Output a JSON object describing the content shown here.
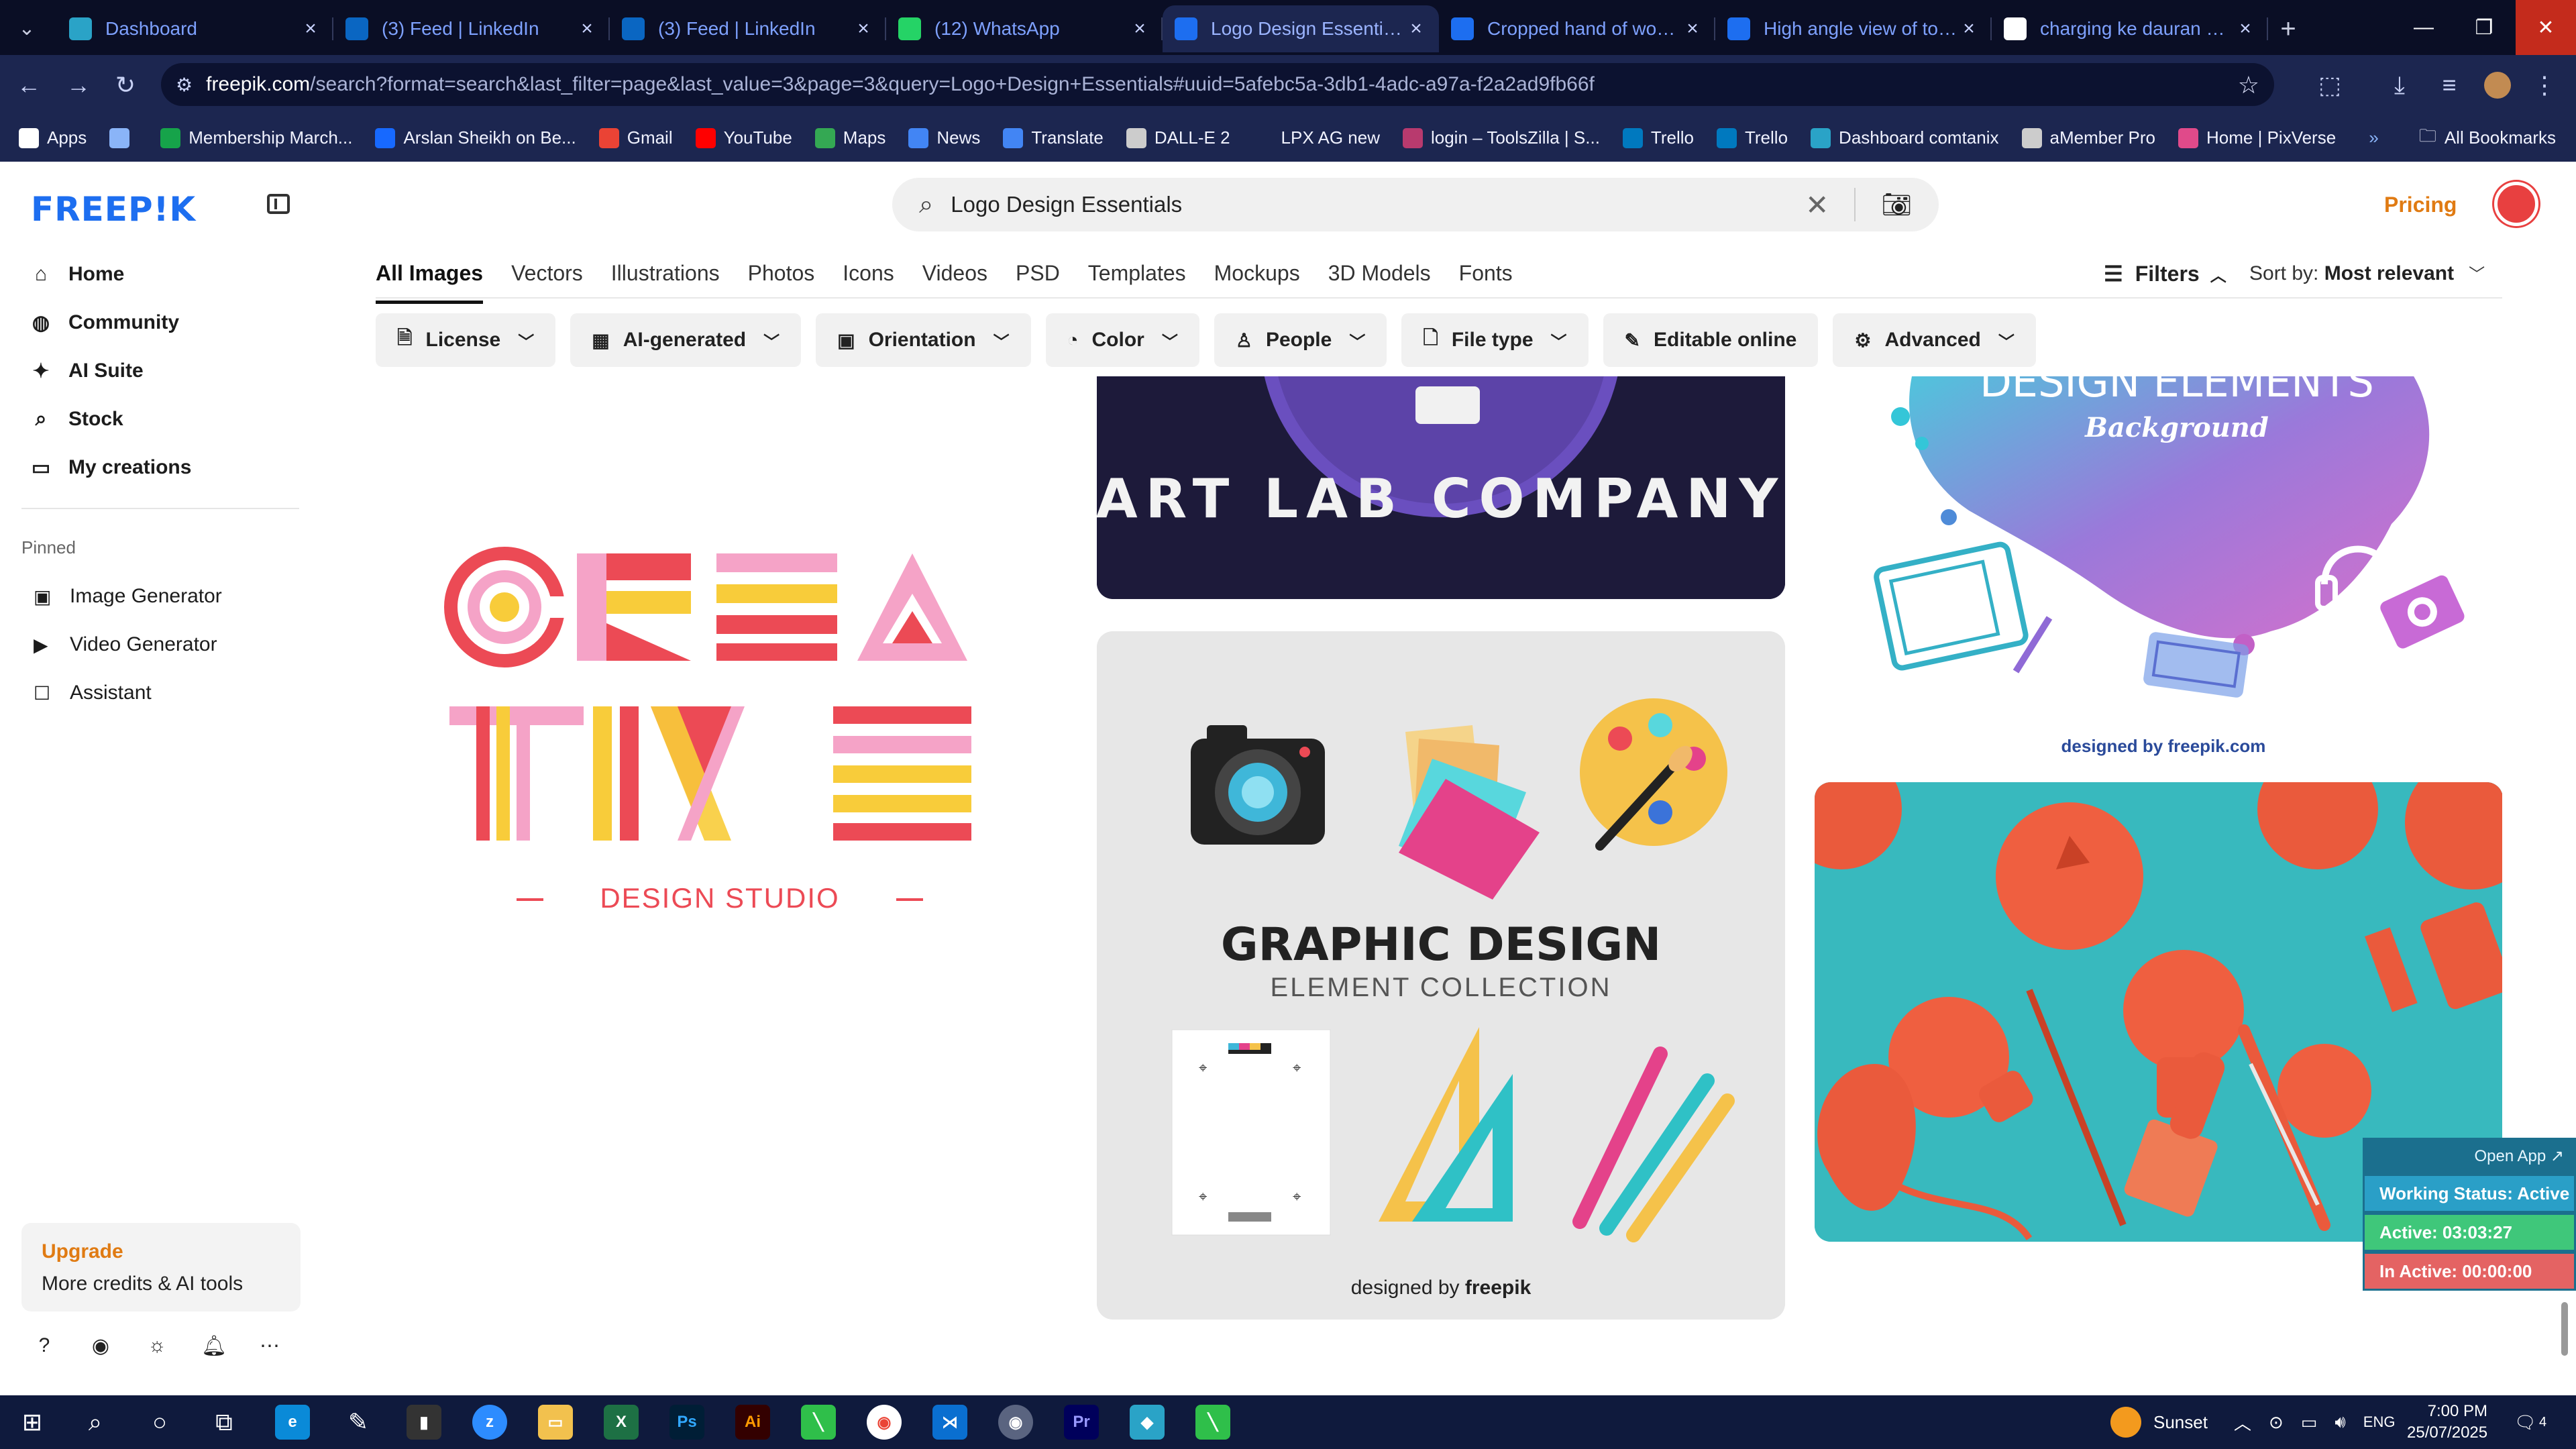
{
  "browser": {
    "tabs": [
      {
        "title": "Dashboard",
        "icon": "dashboard-tab-icon",
        "color": "#2aa3c7"
      },
      {
        "title": "(3) Feed | LinkedIn",
        "icon": "linkedin-icon",
        "color": "#0a66c2"
      },
      {
        "title": "(3) Feed | LinkedIn",
        "icon": "linkedin-icon",
        "color": "#0a66c2"
      },
      {
        "title": "(12) WhatsApp",
        "icon": "whatsapp-icon",
        "color": "#25d366"
      },
      {
        "title": "Logo Design Essentials ve",
        "icon": "freepik-tab-icon",
        "color": "#1d6ef0"
      },
      {
        "title": "Cropped hand of woman",
        "icon": "freepik-tab-icon",
        "color": "#1d6ef0"
      },
      {
        "title": "High angle view of toys s",
        "icon": "freepik-tab-icon",
        "color": "#1d6ef0"
      },
      {
        "title": "charging ke dauran hone",
        "icon": "google-icon",
        "color": "#ffffff"
      }
    ],
    "url_host": "freepik.com",
    "url_path": "/search?format=search&last_filter=page&last_value=3&page=3&query=Logo+Design+Essentials#uuid=5afebc5a-3db1-4adc-a97a-f2a2ad9fb66f",
    "bookmarks": [
      {
        "label": "Apps",
        "color": "#ffffff"
      },
      {
        "label": "",
        "color": "#8ab4f8"
      },
      {
        "label": "Membership March...",
        "color": "#16a34a"
      },
      {
        "label": "Arslan Sheikh on Be...",
        "color": "#1769ff"
      },
      {
        "label": "Gmail",
        "color": "#ea4335"
      },
      {
        "label": "YouTube",
        "color": "#ff0000"
      },
      {
        "label": "Maps",
        "color": "#34a853"
      },
      {
        "label": "News",
        "color": "#4285f4"
      },
      {
        "label": "Translate",
        "color": "#4285f4"
      },
      {
        "label": "DALL-E 2",
        "color": "#cccccc"
      },
      {
        "label": "LPX AG new",
        "color": "#1c2650"
      },
      {
        "label": "login – ToolsZilla | S...",
        "color": "#b83a6e"
      },
      {
        "label": "Trello",
        "color": "#0079bf"
      },
      {
        "label": "Trello",
        "color": "#0079bf"
      },
      {
        "label": "Dashboard comtanix",
        "color": "#2aa3c7"
      },
      {
        "label": "aMember Pro",
        "color": "#cccccc"
      },
      {
        "label": "Home | PixVerse",
        "color": "#e04a8a"
      }
    ],
    "all_bookmarks": "All Bookmarks"
  },
  "sidebar": {
    "logo": "FREEP!K",
    "nav": [
      {
        "label": "Home",
        "icon": "home-icon"
      },
      {
        "label": "Community",
        "icon": "globe-icon"
      },
      {
        "label": "AI Suite",
        "icon": "sparkle-icon"
      },
      {
        "label": "Stock",
        "icon": "search-icon"
      },
      {
        "label": "My creations",
        "icon": "folder-icon"
      }
    ],
    "pinned_heading": "Pinned",
    "pinned": [
      {
        "label": "Image Generator",
        "icon": "image-icon"
      },
      {
        "label": "Video Generator",
        "icon": "video-icon"
      },
      {
        "label": "Assistant",
        "icon": "chat-icon"
      }
    ],
    "upgrade_title": "Upgrade",
    "upgrade_text": "More credits & AI tools"
  },
  "search": {
    "value": "Logo Design Essentials"
  },
  "header": {
    "pricing": "Pricing"
  },
  "types": [
    "All Images",
    "Vectors",
    "Illustrations",
    "Photos",
    "Icons",
    "Videos",
    "PSD",
    "Templates",
    "Mockups",
    "3D Models",
    "Fonts"
  ],
  "filters_label": "Filters",
  "sort_label": "Sort by:",
  "sort_value": "Most relevant",
  "chips": [
    {
      "label": "License",
      "icon": "license-icon"
    },
    {
      "label": "AI-generated",
      "icon": "ai-icon"
    },
    {
      "label": "Orientation",
      "icon": "orientation-icon"
    },
    {
      "label": "Color",
      "icon": "palette-icon"
    },
    {
      "label": "People",
      "icon": "people-icon"
    },
    {
      "label": "File type",
      "icon": "file-icon"
    },
    {
      "label": "Editable online",
      "icon": "pen-icon"
    },
    {
      "label": "Advanced",
      "icon": "gear-icon"
    }
  ],
  "cards": {
    "creative_line1": "CREA",
    "creative_line2": "TIVE",
    "creative_sub": "DESIGN STUDIO",
    "artlab": "ART LAB COMPANY",
    "graphic_title": "GRAPHIC DESIGN",
    "graphic_sub": "ELEMENT COLLECTION",
    "designed_by": "designed by",
    "freepik": "freepik",
    "freepik_com": "freepik.com",
    "elements_title": "DESIGN ELEMENTS",
    "elements_sub": "Background"
  },
  "widget": {
    "open_app": "Open App ↗",
    "status": "Working Status: Active",
    "active": "Active: 03:03:27",
    "inactive": "In Active: 00:00:00"
  },
  "taskbar": {
    "weather": "Sunset",
    "lang": "ENG",
    "time": "7:00 PM",
    "date": "25/07/2025",
    "notifications": "4"
  }
}
